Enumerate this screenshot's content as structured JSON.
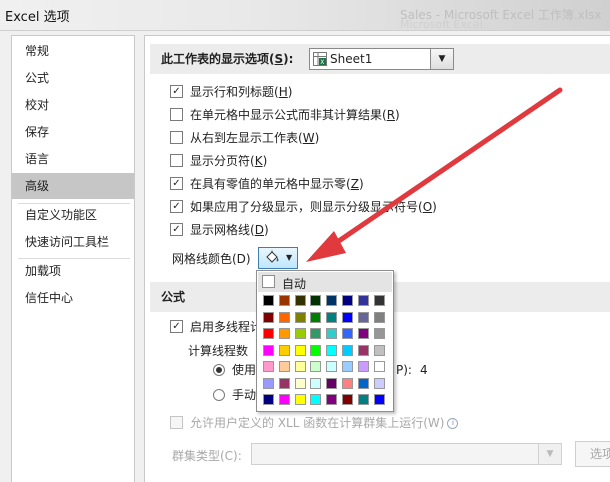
{
  "window": {
    "title": "Excel 选项",
    "ghost_title": "Sales - Microsoft Excel 工作簿.xlsx",
    "ghost_sub": "Microsoft Excel"
  },
  "sidebar": {
    "items": [
      {
        "label": "常规",
        "active": false
      },
      {
        "label": "公式",
        "active": false
      },
      {
        "label": "校对",
        "active": false
      },
      {
        "label": "保存",
        "active": false
      },
      {
        "label": "语言",
        "active": false
      },
      {
        "label": "高级",
        "active": true
      },
      {
        "label": "自定义功能区",
        "active": false
      },
      {
        "label": "快速访问工具栏",
        "active": false
      },
      {
        "label": "加载项",
        "active": false
      },
      {
        "label": "信任中心",
        "active": false
      }
    ]
  },
  "worksheet_section": {
    "header_prefix": "此工作表的显示选项(",
    "header_key": "S",
    "header_suffix": "):",
    "sheet_value": "Sheet1",
    "options": [
      {
        "label": "显示行和列标题",
        "key": "H",
        "checked": true
      },
      {
        "label": "在单元格中显示公式而非其计算结果",
        "key": "R",
        "checked": false
      },
      {
        "label": "从右到左显示工作表",
        "key": "W",
        "checked": false
      },
      {
        "label": "显示分页符",
        "key": "K",
        "checked": false
      },
      {
        "label": "在具有零值的单元格中显示零",
        "key": "Z",
        "checked": true
      },
      {
        "label": "如果应用了分级显示，则显示分级显示符号",
        "key": "O",
        "checked": true
      },
      {
        "label": "显示网格线",
        "key": "D",
        "checked": true
      }
    ],
    "gridline_color_label": "网格线颜色(D)"
  },
  "palette": {
    "auto_label": "自动",
    "colors": [
      [
        "#000000",
        "#993300",
        "#333300",
        "#003300",
        "#003366",
        "#000080",
        "#333399",
        "#333333"
      ],
      [
        "#800000",
        "#ff6600",
        "#808000",
        "#008000",
        "#008080",
        "#0000ff",
        "#666699",
        "#808080"
      ],
      [
        "#ff0000",
        "#ff9900",
        "#99cc00",
        "#339966",
        "#33cccc",
        "#3366ff",
        "#800080",
        "#969696"
      ],
      [
        "#ff00ff",
        "#ffcc00",
        "#ffff00",
        "#00ff00",
        "#00ffff",
        "#00ccff",
        "#993366",
        "#c0c0c0"
      ],
      [
        "#ff99cc",
        "#ffcc99",
        "#ffff99",
        "#ccffcc",
        "#ccffff",
        "#99ccff",
        "#cc99ff",
        "#ffffff"
      ],
      [
        "#9999ff",
        "#993366",
        "#ffffcc",
        "#ccffff",
        "#660066",
        "#ff8080",
        "#0066cc",
        "#ccccff"
      ],
      [
        "#000080",
        "#ff00ff",
        "#ffff00",
        "#00ffff",
        "#800080",
        "#800000",
        "#008080",
        "#0000ff"
      ]
    ]
  },
  "formula_section": {
    "header": "公式",
    "multithread_label": "启用多线程计",
    "thread_count_label": "计算线程数",
    "radio_use_label": "使用",
    "radio_use_suffix": "P):",
    "thread_count_value": "4",
    "radio_manual_label": "手动",
    "xll_label": "允许用户定义的 XLL 函数在计算群集上运行(W)",
    "cluster_type_label": "群集类型(C):",
    "options_button": "选项"
  },
  "colors": {
    "annotation_arrow": "#e0393e",
    "active_nav": "#c6c6c6",
    "focus_border": "#3c7fb1"
  },
  "icons": {
    "excel_sheet": "excel-sheet-icon",
    "paint_bucket": "paint-bucket-icon",
    "info": "info-icon"
  }
}
